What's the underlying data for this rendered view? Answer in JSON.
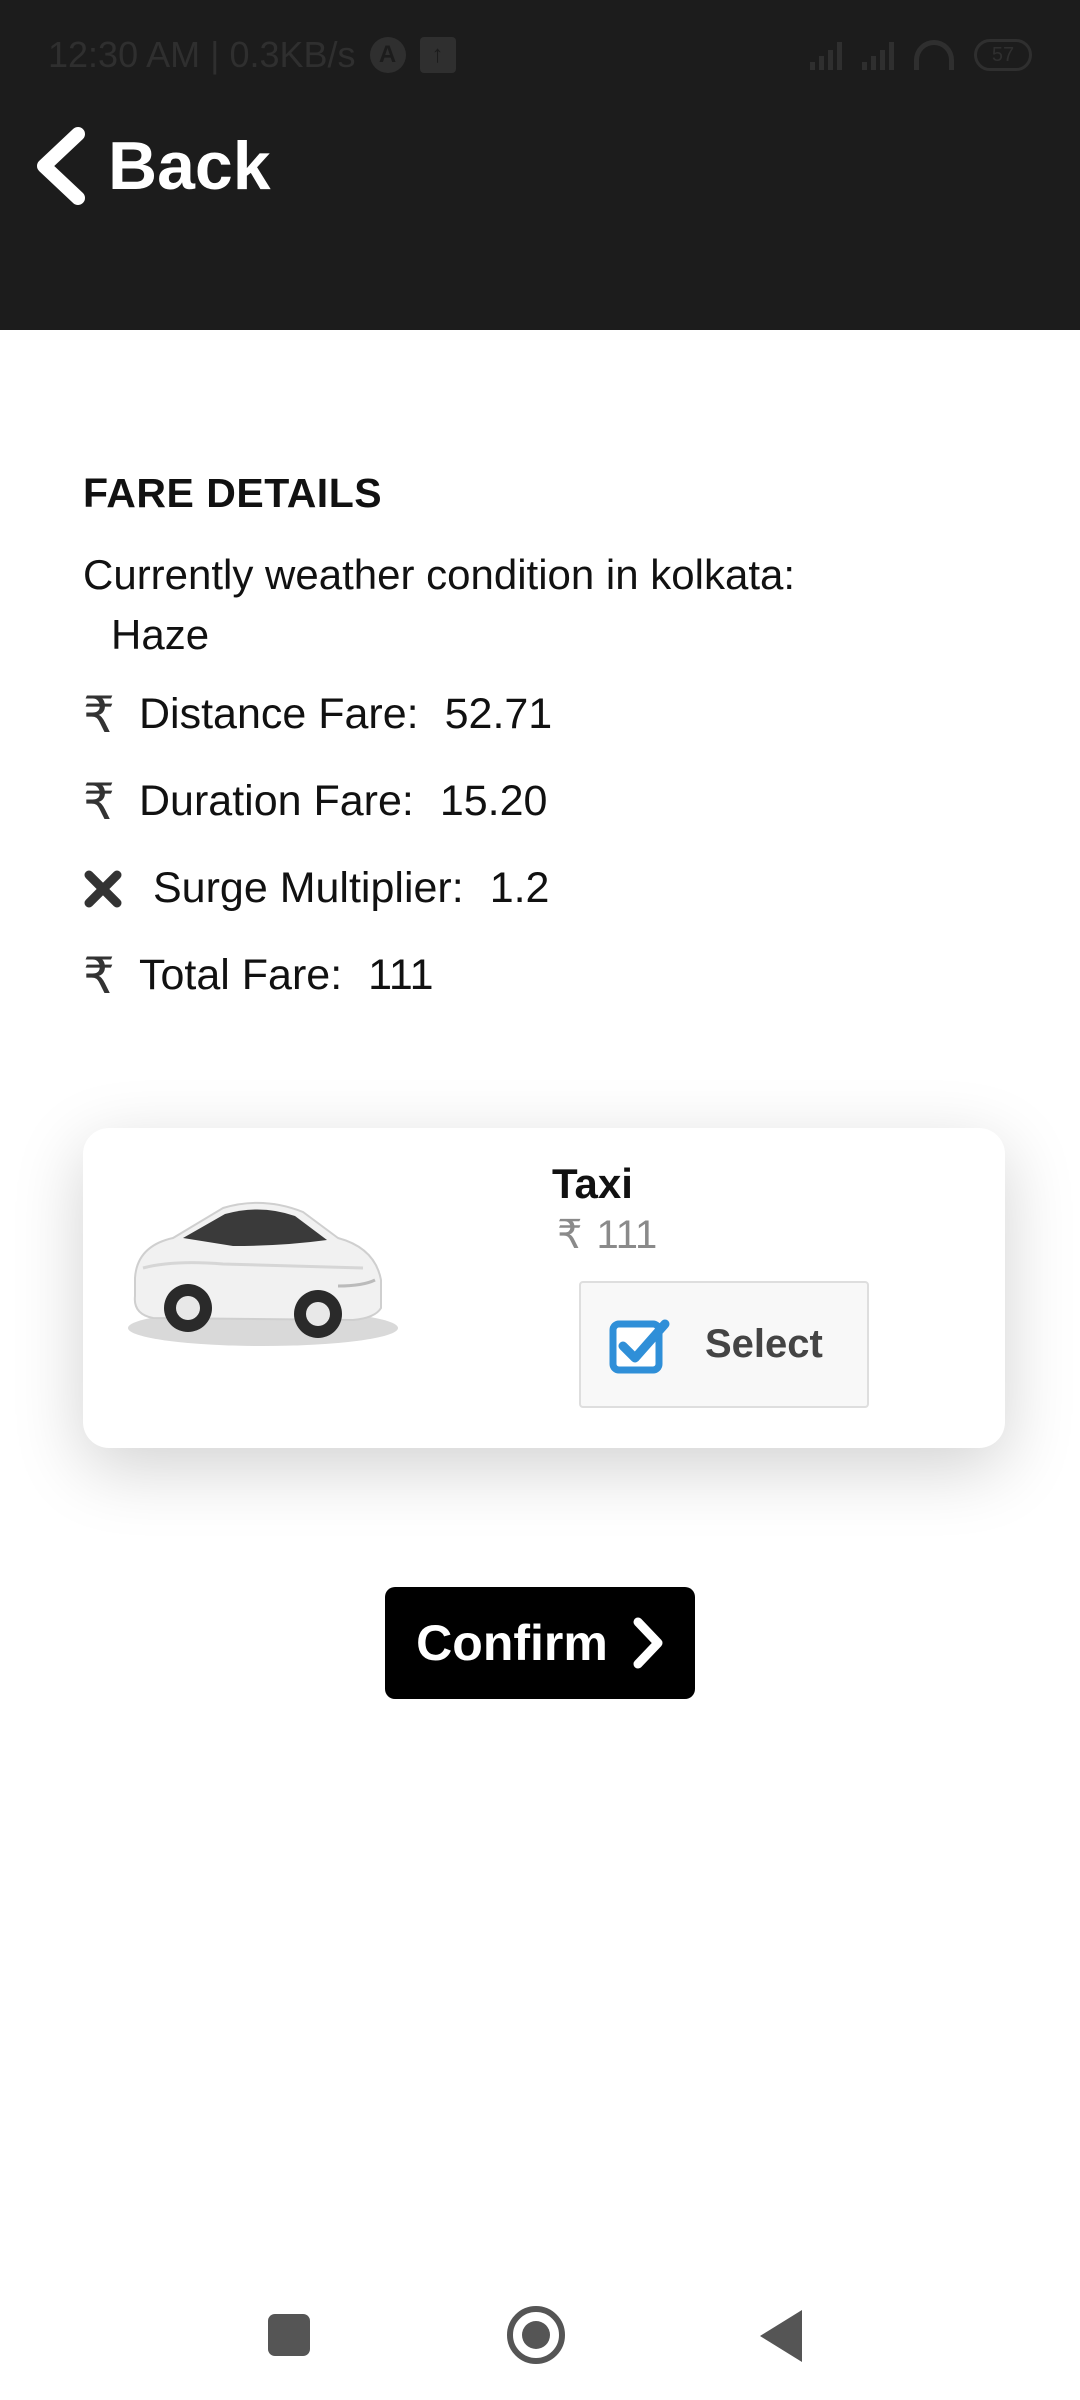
{
  "status_bar": {
    "time_speed": "12:30 AM | 0.3KB/s",
    "battery": "57"
  },
  "header": {
    "back_label": "Back"
  },
  "fare_details": {
    "title": "FARE DETAILS",
    "weather_label": "Currently weather condition in kolkata:",
    "weather_value": "Haze",
    "rows": [
      {
        "icon": "rupee-icon",
        "symbol": "₹",
        "label": "Distance Fare:",
        "value": "52.71"
      },
      {
        "icon": "multiply-icon",
        "symbol": "✖",
        "label": "Surge Multiplier:",
        "value": "1.2"
      },
      {
        "icon": "rupee-icon",
        "symbol": "₹",
        "label": "Duration Fare:",
        "value": "15.20"
      },
      {
        "icon": "rupee-icon",
        "symbol": "₹",
        "label": "Total Fare:",
        "value": "111"
      }
    ]
  },
  "vehicle_card": {
    "name": "Taxi",
    "currency": "₹",
    "price": "111",
    "select_label": "Select",
    "checked": true
  },
  "confirm": {
    "label": "Confirm"
  },
  "colors": {
    "header_bg": "#1c1c1c",
    "checkbox_blue": "#2f8fd8",
    "price_gray": "#8a8a8a"
  }
}
